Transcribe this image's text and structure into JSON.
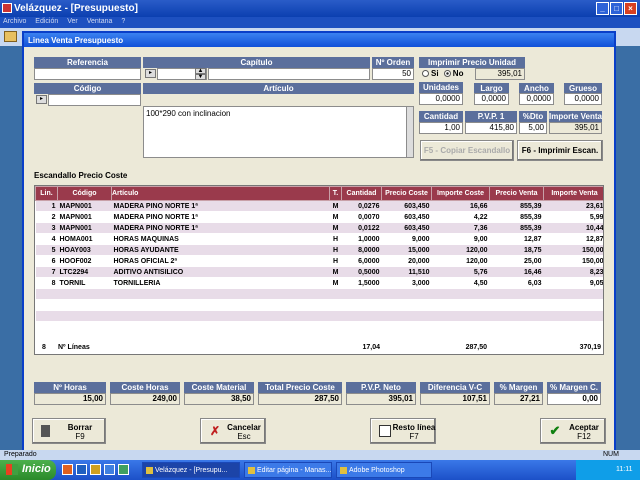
{
  "app": {
    "title": "Velázquez - [Presupuesto]",
    "menu": [
      "Archivo",
      "Edición",
      "Ver",
      "Ventana",
      "?"
    ]
  },
  "dialog": {
    "title": "Linea Venta Presupuesto",
    "labels": {
      "referencia": "Referencia",
      "capitulo": "Capítulo",
      "n_orden": "Nº Orden",
      "imprimir_precio": "Imprimir Precio Unidad",
      "codigo": "Código",
      "articulo": "Artículo",
      "unidades": "Unidades",
      "largo": "Largo",
      "ancho": "Ancho",
      "grueso": "Grueso",
      "cantidad": "Cantidad",
      "pvp": "P.V.P. 1",
      "dto": "%Dto",
      "importe_venta": "Importe Venta"
    },
    "values": {
      "n_orden": "50",
      "precio_unidad": "395,01",
      "unidades": "0,0000",
      "largo": "0,0000",
      "ancho": "0,0000",
      "grueso": "0,0000",
      "cantidad": "1,00",
      "pvp": "415,80",
      "dto": "5,00",
      "importe_venta": "395,01",
      "articulo_text": "100*290  con inclinacion"
    },
    "radio": {
      "si": "Si",
      "no": "No",
      "selected": "No"
    },
    "buttons": {
      "copiar": "F5 - Copiar Escandallo",
      "imprimir": "F6 - Imprimir Escan.",
      "borrar": "Borrar",
      "borrar_key": "F9",
      "cancelar": "Cancelar",
      "cancelar_key": "Esc",
      "resto": "Resto línea",
      "resto_key": "F7",
      "aceptar": "Aceptar",
      "aceptar_key": "F12"
    },
    "escandallo_title": "Escandallo Precio Coste",
    "table": {
      "headers": [
        "Lin.",
        "Código",
        "Artículo",
        "T.",
        "Cantidad",
        "Precio Coste",
        "Importe Coste",
        "Precio Venta",
        "Importe Venta"
      ],
      "rows": [
        [
          "1",
          "MAPN001",
          "MADERA PINO NORTE 1ª",
          "M",
          "0,0276",
          "603,450",
          "16,66",
          "855,39",
          "23,61"
        ],
        [
          "2",
          "MAPN001",
          "MADERA PINO NORTE 1ª",
          "M",
          "0,0070",
          "603,450",
          "4,22",
          "855,39",
          "5,99"
        ],
        [
          "3",
          "MAPN001",
          "MADERA PINO NORTE 1ª",
          "M",
          "0,0122",
          "603,450",
          "7,36",
          "855,39",
          "10,44"
        ],
        [
          "4",
          "HOMA001",
          "HORAS MAQUINAS",
          "H",
          "1,0000",
          "9,000",
          "9,00",
          "12,87",
          "12,87"
        ],
        [
          "5",
          "HOAY003",
          "HORAS AYUDANTE",
          "H",
          "8,0000",
          "15,000",
          "120,00",
          "18,75",
          "150,00"
        ],
        [
          "6",
          "HOOF002",
          "HORAS OFICIAL 2ª",
          "H",
          "6,0000",
          "20,000",
          "120,00",
          "25,00",
          "150,00"
        ],
        [
          "7",
          "LTC2294",
          "ADITIVO ANTISILICO",
          "M",
          "0,5000",
          "11,510",
          "5,76",
          "16,46",
          "8,23"
        ],
        [
          "8",
          "TORNIL",
          "TORNILLERIA",
          "M",
          "1,5000",
          "3,000",
          "4,50",
          "6,03",
          "9,05"
        ]
      ]
    },
    "totals": {
      "n_lineas": "8",
      "n_lineas_label": "Nº Líneas",
      "cantidad": "17,04",
      "importe_coste": "287,50",
      "importe_venta": "370,19"
    },
    "footer": [
      {
        "label": "Nº Horas",
        "value": "15,00"
      },
      {
        "label": "Coste Horas",
        "value": "249,00"
      },
      {
        "label": "Coste Material",
        "value": "38,50"
      },
      {
        "label": "Total Precio Coste",
        "value": "287,50"
      },
      {
        "label": "P.V.P. Neto",
        "value": "395,01"
      },
      {
        "label": "Diferencia V-C",
        "value": "107,51"
      },
      {
        "label": "% Margen",
        "value": "27,21"
      },
      {
        "label": "% Margen C.",
        "value": "0,00"
      }
    ]
  },
  "status": {
    "left": "Preparado",
    "right": "NUM"
  },
  "taskbar": {
    "start": "Inicio",
    "tasks": [
      "Velázquez - [Presupu...",
      "Editar página - Manas...",
      "Adobe Photoshop"
    ],
    "time": "11:11"
  },
  "colors": {
    "header_blue": "#5b6f9c",
    "table_header": "#9a3a4c",
    "dialog_title": "#1050d8"
  }
}
